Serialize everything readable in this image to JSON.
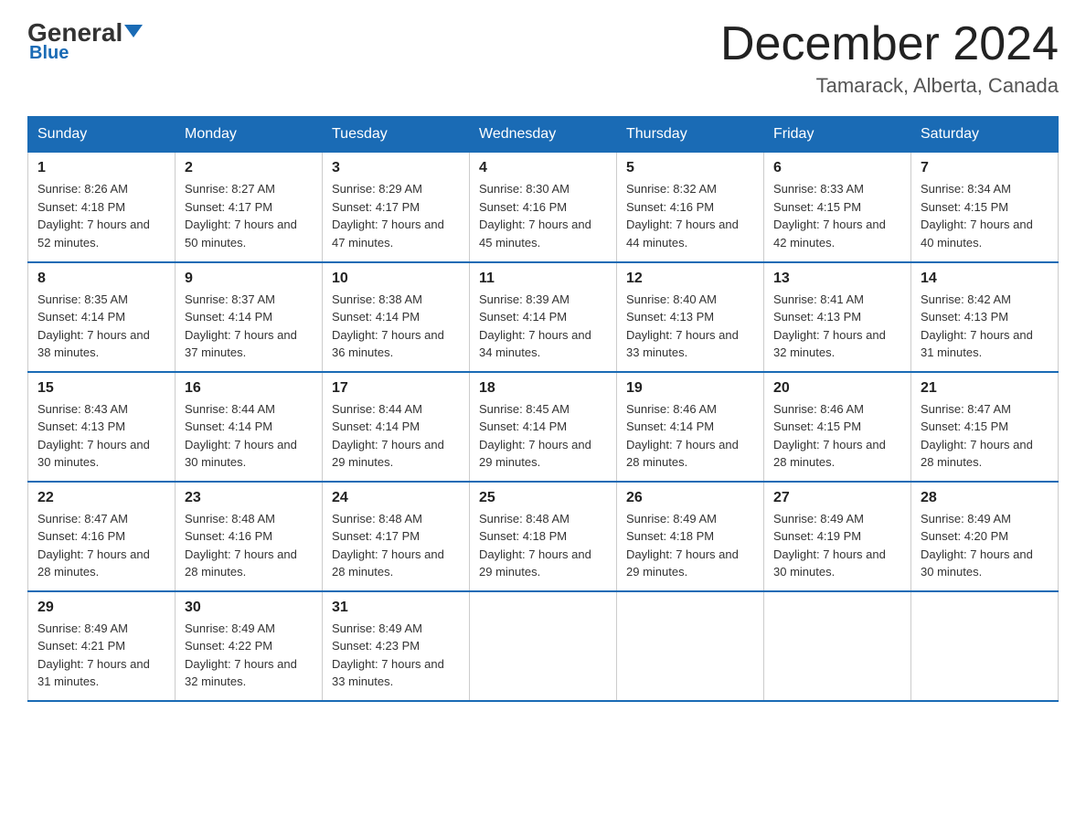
{
  "header": {
    "logo_text": "General",
    "logo_blue": "Blue",
    "month_title": "December 2024",
    "location": "Tamarack, Alberta, Canada"
  },
  "weekdays": [
    "Sunday",
    "Monday",
    "Tuesday",
    "Wednesday",
    "Thursday",
    "Friday",
    "Saturday"
  ],
  "weeks": [
    [
      {
        "day": "1",
        "sunrise": "8:26 AM",
        "sunset": "4:18 PM",
        "daylight": "7 hours and 52 minutes."
      },
      {
        "day": "2",
        "sunrise": "8:27 AM",
        "sunset": "4:17 PM",
        "daylight": "7 hours and 50 minutes."
      },
      {
        "day": "3",
        "sunrise": "8:29 AM",
        "sunset": "4:17 PM",
        "daylight": "7 hours and 47 minutes."
      },
      {
        "day": "4",
        "sunrise": "8:30 AM",
        "sunset": "4:16 PM",
        "daylight": "7 hours and 45 minutes."
      },
      {
        "day": "5",
        "sunrise": "8:32 AM",
        "sunset": "4:16 PM",
        "daylight": "7 hours and 44 minutes."
      },
      {
        "day": "6",
        "sunrise": "8:33 AM",
        "sunset": "4:15 PM",
        "daylight": "7 hours and 42 minutes."
      },
      {
        "day": "7",
        "sunrise": "8:34 AM",
        "sunset": "4:15 PM",
        "daylight": "7 hours and 40 minutes."
      }
    ],
    [
      {
        "day": "8",
        "sunrise": "8:35 AM",
        "sunset": "4:14 PM",
        "daylight": "7 hours and 38 minutes."
      },
      {
        "day": "9",
        "sunrise": "8:37 AM",
        "sunset": "4:14 PM",
        "daylight": "7 hours and 37 minutes."
      },
      {
        "day": "10",
        "sunrise": "8:38 AM",
        "sunset": "4:14 PM",
        "daylight": "7 hours and 36 minutes."
      },
      {
        "day": "11",
        "sunrise": "8:39 AM",
        "sunset": "4:14 PM",
        "daylight": "7 hours and 34 minutes."
      },
      {
        "day": "12",
        "sunrise": "8:40 AM",
        "sunset": "4:13 PM",
        "daylight": "7 hours and 33 minutes."
      },
      {
        "day": "13",
        "sunrise": "8:41 AM",
        "sunset": "4:13 PM",
        "daylight": "7 hours and 32 minutes."
      },
      {
        "day": "14",
        "sunrise": "8:42 AM",
        "sunset": "4:13 PM",
        "daylight": "7 hours and 31 minutes."
      }
    ],
    [
      {
        "day": "15",
        "sunrise": "8:43 AM",
        "sunset": "4:13 PM",
        "daylight": "7 hours and 30 minutes."
      },
      {
        "day": "16",
        "sunrise": "8:44 AM",
        "sunset": "4:14 PM",
        "daylight": "7 hours and 30 minutes."
      },
      {
        "day": "17",
        "sunrise": "8:44 AM",
        "sunset": "4:14 PM",
        "daylight": "7 hours and 29 minutes."
      },
      {
        "day": "18",
        "sunrise": "8:45 AM",
        "sunset": "4:14 PM",
        "daylight": "7 hours and 29 minutes."
      },
      {
        "day": "19",
        "sunrise": "8:46 AM",
        "sunset": "4:14 PM",
        "daylight": "7 hours and 28 minutes."
      },
      {
        "day": "20",
        "sunrise": "8:46 AM",
        "sunset": "4:15 PM",
        "daylight": "7 hours and 28 minutes."
      },
      {
        "day": "21",
        "sunrise": "8:47 AM",
        "sunset": "4:15 PM",
        "daylight": "7 hours and 28 minutes."
      }
    ],
    [
      {
        "day": "22",
        "sunrise": "8:47 AM",
        "sunset": "4:16 PM",
        "daylight": "7 hours and 28 minutes."
      },
      {
        "day": "23",
        "sunrise": "8:48 AM",
        "sunset": "4:16 PM",
        "daylight": "7 hours and 28 minutes."
      },
      {
        "day": "24",
        "sunrise": "8:48 AM",
        "sunset": "4:17 PM",
        "daylight": "7 hours and 28 minutes."
      },
      {
        "day": "25",
        "sunrise": "8:48 AM",
        "sunset": "4:18 PM",
        "daylight": "7 hours and 29 minutes."
      },
      {
        "day": "26",
        "sunrise": "8:49 AM",
        "sunset": "4:18 PM",
        "daylight": "7 hours and 29 minutes."
      },
      {
        "day": "27",
        "sunrise": "8:49 AM",
        "sunset": "4:19 PM",
        "daylight": "7 hours and 30 minutes."
      },
      {
        "day": "28",
        "sunrise": "8:49 AM",
        "sunset": "4:20 PM",
        "daylight": "7 hours and 30 minutes."
      }
    ],
    [
      {
        "day": "29",
        "sunrise": "8:49 AM",
        "sunset": "4:21 PM",
        "daylight": "7 hours and 31 minutes."
      },
      {
        "day": "30",
        "sunrise": "8:49 AM",
        "sunset": "4:22 PM",
        "daylight": "7 hours and 32 minutes."
      },
      {
        "day": "31",
        "sunrise": "8:49 AM",
        "sunset": "4:23 PM",
        "daylight": "7 hours and 33 minutes."
      },
      null,
      null,
      null,
      null
    ]
  ]
}
